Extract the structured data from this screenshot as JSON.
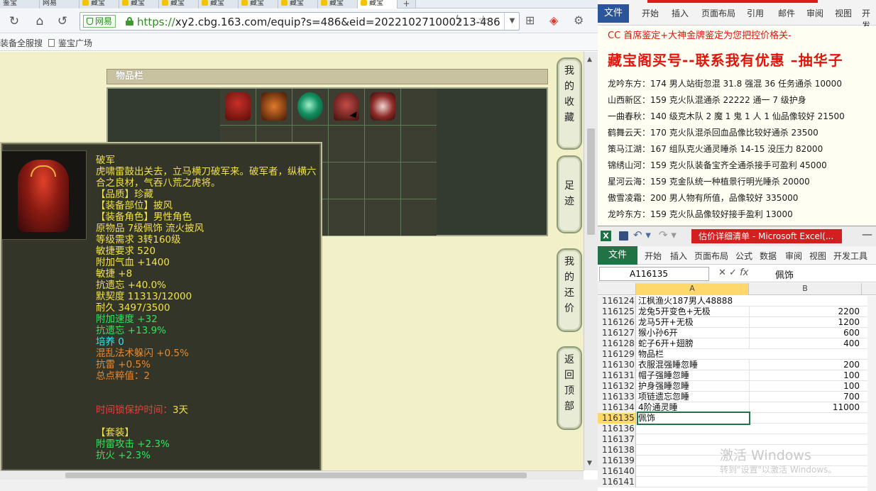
{
  "browser": {
    "tabs": [
      {
        "label": "鉴宝"
      },
      {
        "label": "网易"
      },
      {
        "label": "藏宝"
      },
      {
        "label": "藏宝"
      },
      {
        "label": "藏宝"
      },
      {
        "label": "藏宝"
      },
      {
        "label": "藏宝"
      },
      {
        "label": "藏宝"
      },
      {
        "label": "藏宝"
      },
      {
        "label": "藏宝"
      }
    ],
    "add_tab": "+",
    "site_badge": "网易",
    "url_scheme": "https://",
    "url_rest": "xy2.cbg.163.com/equip?s=486&eid=202210271000213-486",
    "bookmarks": [
      "装备全服搜",
      "鉴宝广场"
    ]
  },
  "inventory": {
    "header": "物品栏",
    "item_colors": [
      "#c8302a",
      "#e07b2a",
      "#139061",
      "#c44c47",
      "#8e2b27"
    ]
  },
  "tooltip": {
    "name": "破军",
    "desc": "虎啸雷鼓出关去，立马横刀破军来。破军者，纵横六合之良材，气吞八荒之虎将。",
    "quality": "【品质】珍藏",
    "slot": "【装备部位】披风",
    "role": "【装备角色】男性角色",
    "origin": "原物品 7级佩饰 流火披风",
    "level_req": "等级需求 3转160级",
    "agi_req": "敏捷要求 520",
    "hp": "附加气血 +1400",
    "agi": "敏捷 +8",
    "resist_forget": "抗遗忘 +40.0%",
    "tacit": "默契度 11313/12000",
    "durability": "耐久 3497/3500",
    "speed": "附加速度 +32",
    "resist_forget2": "抗遗忘 +13.9%",
    "cultivate": "培养 0",
    "chaos_dodge": "混乱法术躲闪 +0.5%",
    "resist_thunder": "抗雷 +0.5%",
    "total_points": "总点粹值：2",
    "protect_label": "时间锁保护时间：",
    "protect_value": "3天",
    "set_label": "【套装】",
    "set_1": "附雷攻击 +2.3%",
    "set_2": "抗火 +2.3%"
  },
  "sidenav": [
    {
      "label": "我的收藏"
    },
    {
      "label": "足迹"
    },
    {
      "label": "我的还价"
    },
    {
      "label": "返回顶部"
    }
  ],
  "word": {
    "file_tab": "文件",
    "tabs": [
      "开始",
      "插入",
      "页面布局",
      "引用",
      "邮件",
      "审阅",
      "视图",
      "开发"
    ],
    "line0": "CC 首席鉴定+大神金牌鉴定为您把控价格关-",
    "title": "藏宝阁买号--联系我有优惠 –抽华子",
    "rows": [
      "龙吟东方：174 男人站街忽混 31.8 强混 36 任务通杀 10000",
      "山西新区：159 克火队混通杀 22222 通一 7 级护身",
      "一曲春秋：140 级克木队 2 魔 1 鬼 1 人 1 仙品像较好 21500",
      "鹤舞云天：170 克火队混杀回血品像比较好通杀 23500",
      "策马江湖：167 组队克火通灵睡杀 14-15 没压力 82000",
      "锦绣山河：159 克火队装备宝齐全通杀接手可盈利 45000",
      "星河云海：159 克金队统一种植景行明光睡杀 20000",
      "傲雪凌霜：200 男人物有所值，品像较好 335000",
      "龙吟东方：159 克火队品像较好接手盈利 13000"
    ]
  },
  "excel": {
    "caption": "估价详细清单 - Microsoft Excel(...",
    "file_tab": "文件",
    "tabs": [
      "开始",
      "插入",
      "页面布局",
      "公式",
      "数据",
      "审阅",
      "视图",
      "开发工具"
    ],
    "name_box": "A116135",
    "formula_value": "佩饰",
    "col_a": "A",
    "col_b": "B",
    "rows": [
      {
        "n": "116124",
        "a": "江枫渔火187男人48888",
        "b": ""
      },
      {
        "n": "116125",
        "a": "龙兔5开变色+无极",
        "b": "2200"
      },
      {
        "n": "116126",
        "a": "龙马5开+无极",
        "b": "1200"
      },
      {
        "n": "116127",
        "a": "猴小孙6开",
        "b": "600"
      },
      {
        "n": "116128",
        "a": "蛇子6开+翅膀",
        "b": "400"
      },
      {
        "n": "116129",
        "a": "物品栏",
        "b": ""
      },
      {
        "n": "116130",
        "a": "衣服混强睡忽睡",
        "b": "200"
      },
      {
        "n": "116131",
        "a": "帽子强睡忽睡",
        "b": "100"
      },
      {
        "n": "116132",
        "a": "护身强睡忽睡",
        "b": "100"
      },
      {
        "n": "116133",
        "a": "项链遗忘忽睡",
        "b": "700"
      },
      {
        "n": "116134",
        "a": "4阶通灵睡",
        "b": "11000"
      },
      {
        "n": "116135",
        "a": "佩饰",
        "b": ""
      },
      {
        "n": "116136",
        "a": "",
        "b": ""
      },
      {
        "n": "116137",
        "a": "",
        "b": ""
      },
      {
        "n": "116138",
        "a": "",
        "b": ""
      },
      {
        "n": "116139",
        "a": "",
        "b": ""
      },
      {
        "n": "116140",
        "a": "",
        "b": ""
      },
      {
        "n": "116141",
        "a": "",
        "b": ""
      }
    ],
    "selected_row": "116135",
    "activation_title": "激活 Windows",
    "activation_sub": "转到\"设置\"以激活 Windows。"
  }
}
